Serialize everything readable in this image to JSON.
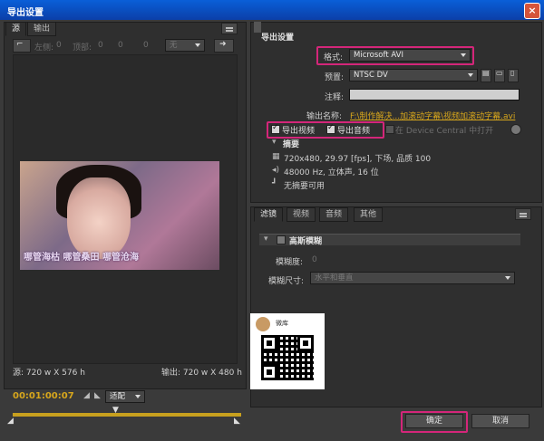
{
  "window": {
    "title": "导出设置",
    "close": "×"
  },
  "left": {
    "tabs": [
      "源",
      "输出"
    ],
    "crop_labels": {
      "left": "左侧:",
      "left_val": "0",
      "top": "顶部:",
      "top_val": "0",
      "right_val": "0",
      "bottom_val": "0"
    },
    "fit_select": "无",
    "source_info": "源: 720 w X 576 h",
    "output_info": "输出: 720 w X 480 h",
    "subtitle_text": "哪管海枯 哪管桑田 哪管沧海",
    "timecode": "00:01:00:07",
    "zoom_select": "适配"
  },
  "export": {
    "section_title": "导出设置",
    "format_label": "格式:",
    "format_value": "Microsoft AVI",
    "preset_label": "预置:",
    "preset_value": "NTSC DV",
    "comment_label": "注释:",
    "comment_value": "",
    "output_name_label": "输出名称:",
    "output_name_value": "F:\\制作解决...加滚动字幕\\视频加滚动字幕.avi",
    "export_video": "导出视频",
    "export_audio": "导出音频",
    "device_central": "在 Device Central 中打开",
    "summary_title": "摘要",
    "summary_video": "720x480, 29.97 [fps], 下场, 品质 100",
    "summary_audio": "48000 Hz, 立体声, 16 位",
    "summary_meta": "无摘要可用"
  },
  "effects": {
    "tabs": [
      "滤镜",
      "视频",
      "音频",
      "其他"
    ],
    "filter_name": "高斯模糊",
    "blur_label": "模糊度:",
    "blur_value": "0",
    "blur_dim_label": "模糊尺寸:",
    "blur_dim_value": "水平和垂直"
  },
  "qr": {
    "name": "微库",
    "caption": "..."
  },
  "buttons": {
    "ok": "确定",
    "cancel": "取消"
  },
  "colors": {
    "highlight": "#d4267a",
    "accent": "#c8a01e",
    "title_bar": "#0a5fd8"
  }
}
